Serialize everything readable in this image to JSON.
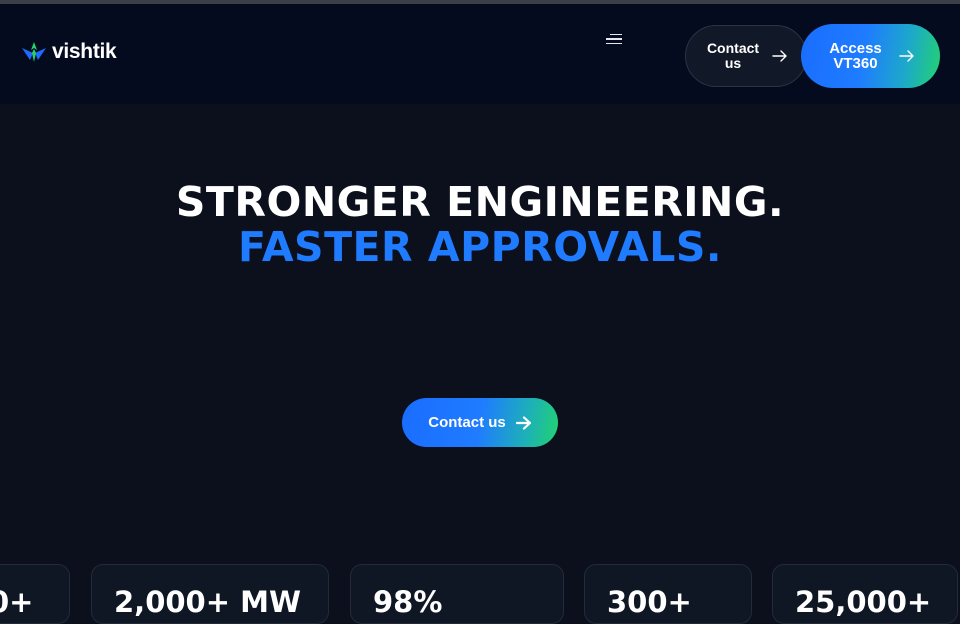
{
  "header": {
    "logo_text": "vishtik",
    "menu_icon": "hamburger-menu-icon",
    "contact_label": "Contact us",
    "access_label": "Access VT360"
  },
  "hero": {
    "line1": "STRONGER ENGINEERING.",
    "line2": "FASTER APPROVALS.",
    "cta_label": "Contact us"
  },
  "stats": [
    {
      "value": "0+"
    },
    {
      "value": "2,000+ MW"
    },
    {
      "value": "98%"
    },
    {
      "value": "300+"
    },
    {
      "value": "25,000+"
    }
  ],
  "colors": {
    "background": "#0b101c",
    "header_background": "#040b1e",
    "accent_blue": "#1f7bff",
    "accent_green": "#22d36e"
  }
}
